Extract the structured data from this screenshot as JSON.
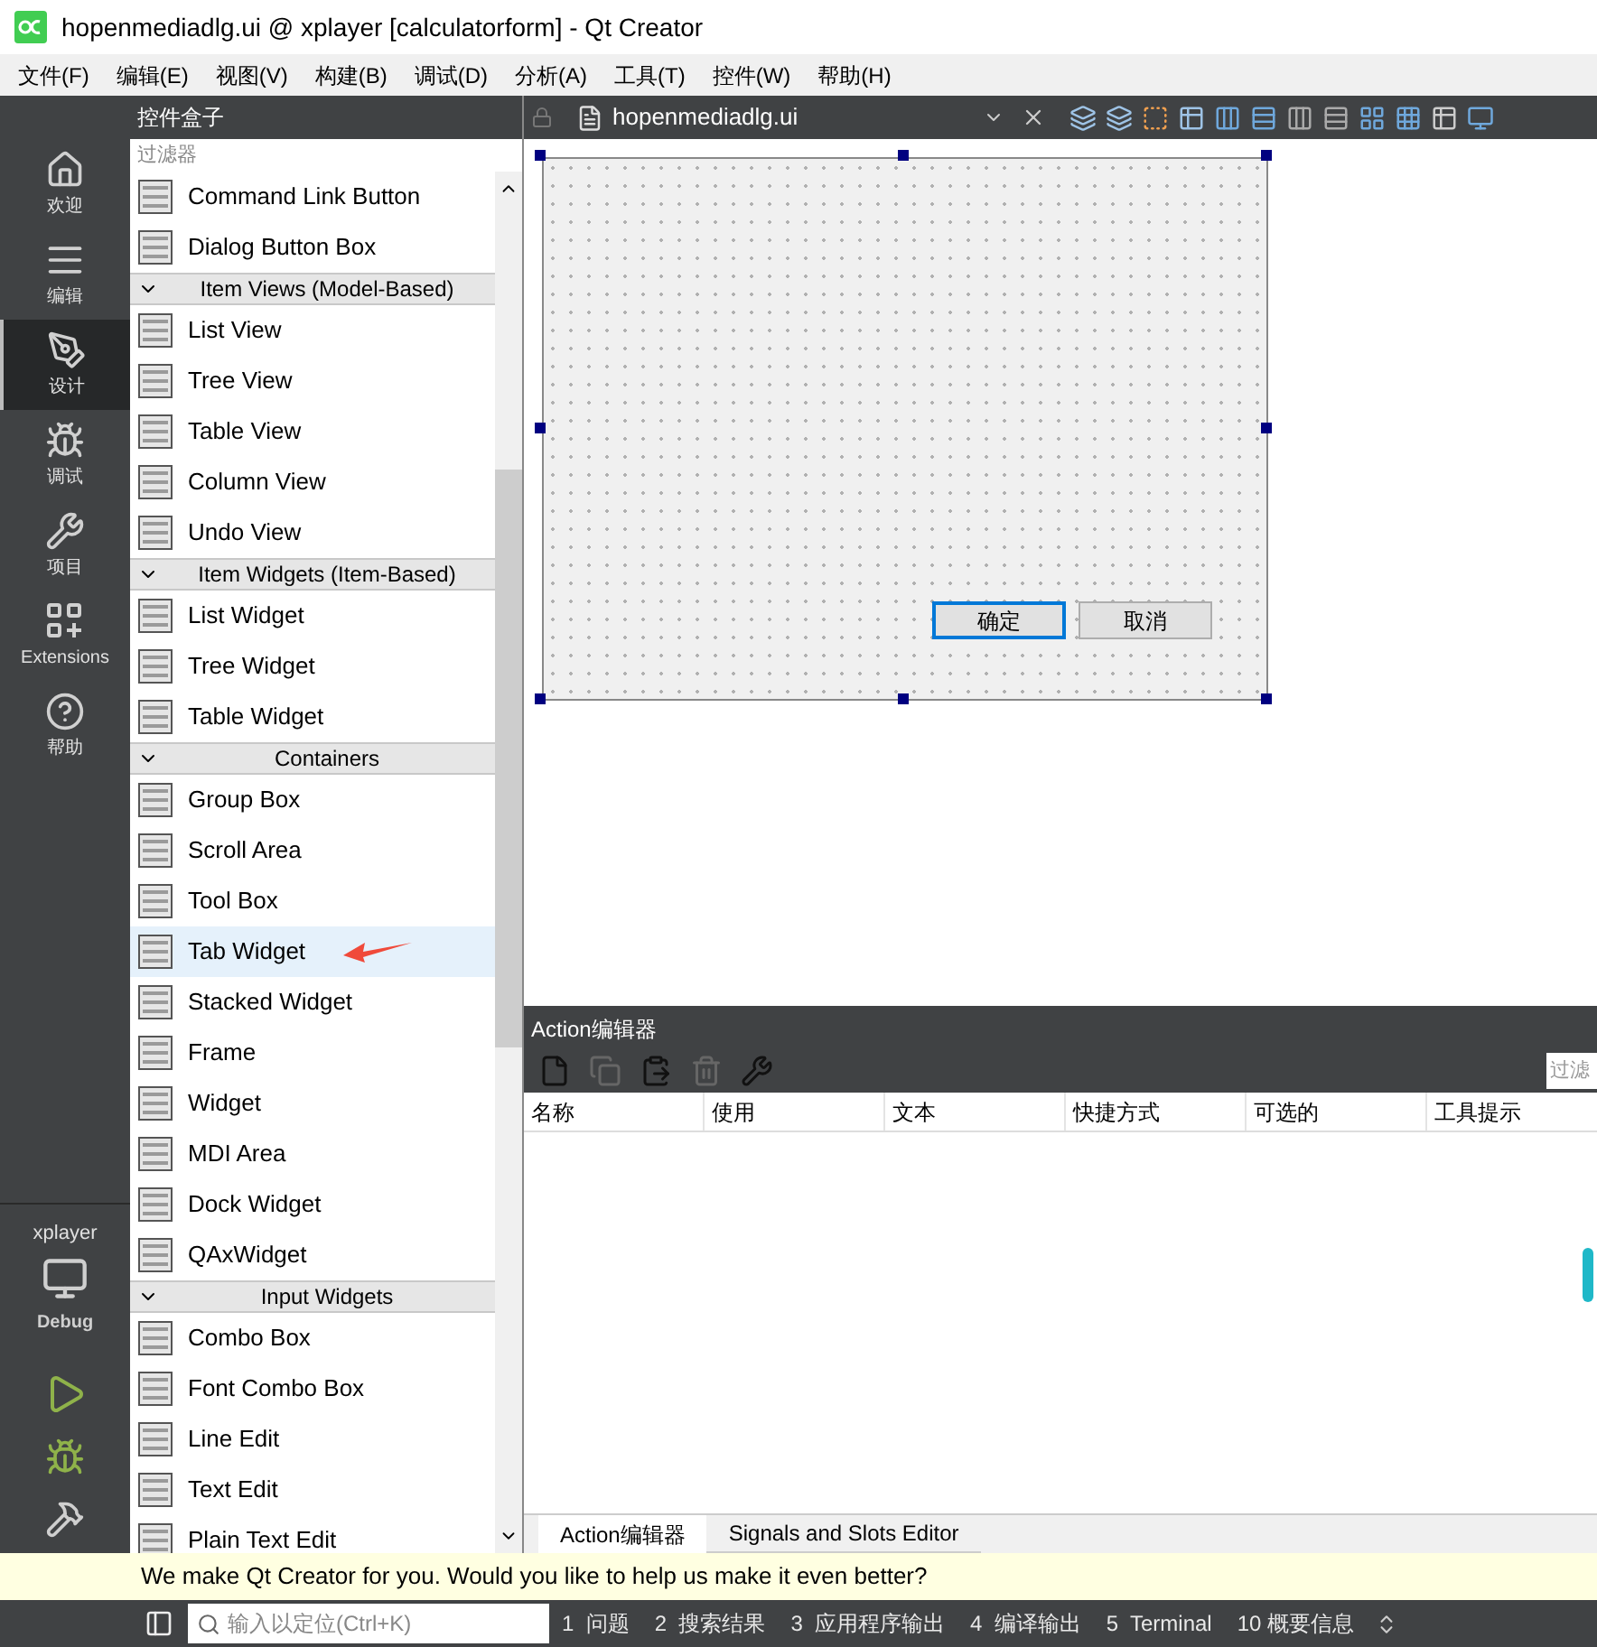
{
  "window": {
    "title": "hopenmediadlg.ui @ xplayer [calculatorform] - Qt Creator"
  },
  "menu": [
    "文件(F)",
    "编辑(E)",
    "视图(V)",
    "构建(B)",
    "调试(D)",
    "分析(A)",
    "工具(T)",
    "控件(W)",
    "帮助(H)"
  ],
  "modes": [
    {
      "label": "欢迎",
      "selected": false
    },
    {
      "label": "编辑",
      "selected": false
    },
    {
      "label": "设计",
      "selected": true
    },
    {
      "label": "调试",
      "selected": false
    },
    {
      "label": "项目",
      "selected": false
    },
    {
      "label": "Extensions",
      "selected": false
    },
    {
      "label": "帮助",
      "selected": false
    }
  ],
  "target": {
    "project": "xplayer",
    "config": "Debug"
  },
  "widget_box": {
    "title": "控件盒子",
    "filter": {
      "placeholder": "过滤器"
    },
    "items": [
      {
        "kind": "item",
        "label": "Command Link Button",
        "selected": false
      },
      {
        "kind": "item",
        "label": "Dialog Button Box",
        "selected": false
      },
      {
        "kind": "category",
        "label": "Item Views (Model-Based)"
      },
      {
        "kind": "item",
        "label": "List View",
        "selected": false
      },
      {
        "kind": "item",
        "label": "Tree View",
        "selected": false
      },
      {
        "kind": "item",
        "label": "Table View",
        "selected": false
      },
      {
        "kind": "item",
        "label": "Column View",
        "selected": false
      },
      {
        "kind": "item",
        "label": "Undo View",
        "selected": false
      },
      {
        "kind": "category",
        "label": "Item Widgets (Item-Based)"
      },
      {
        "kind": "item",
        "label": "List Widget",
        "selected": false
      },
      {
        "kind": "item",
        "label": "Tree Widget",
        "selected": false
      },
      {
        "kind": "item",
        "label": "Table Widget",
        "selected": false
      },
      {
        "kind": "category",
        "label": "Containers"
      },
      {
        "kind": "item",
        "label": "Group Box",
        "selected": false
      },
      {
        "kind": "item",
        "label": "Scroll Area",
        "selected": false
      },
      {
        "kind": "item",
        "label": "Tool Box",
        "selected": false
      },
      {
        "kind": "item",
        "label": "Tab Widget",
        "selected": true,
        "marked": true
      },
      {
        "kind": "item",
        "label": "Stacked Widget",
        "selected": false
      },
      {
        "kind": "item",
        "label": "Frame",
        "selected": false
      },
      {
        "kind": "item",
        "label": "Widget",
        "selected": false
      },
      {
        "kind": "item",
        "label": "MDI Area",
        "selected": false
      },
      {
        "kind": "item",
        "label": "Dock Widget",
        "selected": false
      },
      {
        "kind": "item",
        "label": "QAxWidget",
        "selected": false
      },
      {
        "kind": "category",
        "label": "Input Widgets"
      },
      {
        "kind": "item",
        "label": "Combo Box",
        "selected": false
      },
      {
        "kind": "item",
        "label": "Font Combo Box",
        "selected": false
      },
      {
        "kind": "item",
        "label": "Line Edit",
        "selected": false
      },
      {
        "kind": "item",
        "label": "Text Edit",
        "selected": false
      },
      {
        "kind": "item",
        "label": "Plain Text Edit",
        "selected": false
      }
    ]
  },
  "editor": {
    "file": "hopenmediadlg.ui",
    "form_buttons": [
      {
        "label": "确定",
        "selected": true
      },
      {
        "label": "取消",
        "selected": false
      }
    ]
  },
  "action_editor": {
    "title": "Action编辑器",
    "filter": {
      "placeholder": "过滤"
    },
    "columns": [
      "名称",
      "使用",
      "文本",
      "快捷方式",
      "可选的",
      "工具提示"
    ]
  },
  "bottom_tabs": [
    {
      "label": "Action编辑器",
      "selected": true
    },
    {
      "label": "Signals and Slots Editor",
      "selected": false
    }
  ],
  "feedback": "We make Qt Creator for you. Would you like to help us make it even better?",
  "status_bar": {
    "locator": {
      "placeholder": "输入以定位(Ctrl+K)"
    },
    "panes": [
      "1  问题",
      "2  搜索结果",
      "3  应用程序输出",
      "4  编译输出",
      "5  Terminal",
      "10 概要信息"
    ]
  }
}
